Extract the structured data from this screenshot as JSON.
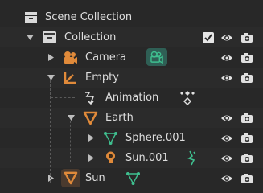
{
  "outliner": {
    "root": {
      "label": "Scene Collection",
      "icon": "scene-collection-icon"
    },
    "rows": [
      {
        "label": "Collection",
        "icon": "collection-icon",
        "expanded": true,
        "checked": true
      },
      {
        "label": "Camera",
        "icon": "camera-object-icon",
        "expanded": false,
        "data_icon": "camera-data-icon"
      },
      {
        "label": "Empty",
        "icon": "empty-object-icon",
        "expanded": true
      },
      {
        "label": "Animation",
        "icon": "animation-icon",
        "data_icon": "keyframe-icon"
      },
      {
        "label": "Earth",
        "icon": "mesh-object-icon",
        "expanded": true
      },
      {
        "label": "Sphere.001",
        "icon": "mesh-data-icon",
        "expanded": false
      },
      {
        "label": "Sun.001",
        "icon": "light-object-icon",
        "expanded": false,
        "data_icon": "modifier-icon"
      },
      {
        "label": "Sun",
        "icon": "mesh-object-icon",
        "expanded": false,
        "data_icon": "mesh-data-icon"
      }
    ],
    "visibility_icon": "eye-icon",
    "render_icon": "camera-render-icon"
  },
  "colors": {
    "background": "#282828",
    "row_alt": "#2b2b2b",
    "object_orange": "#e08a3a",
    "data_green": "#3fbf8f",
    "text": "#dedede",
    "icon_white": "#e0e0e0"
  }
}
